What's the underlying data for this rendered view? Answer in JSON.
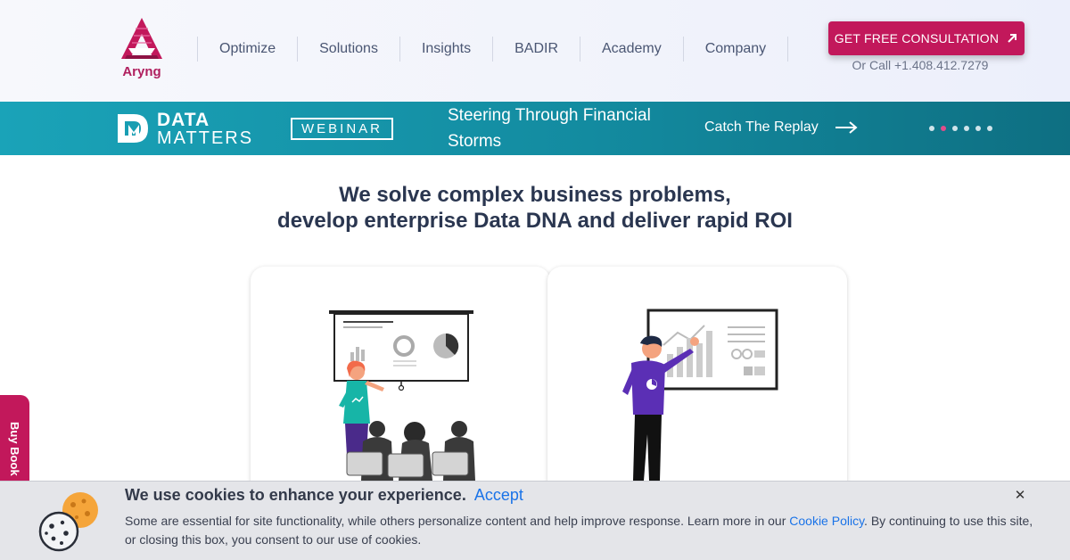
{
  "header": {
    "logo_text": "Aryng",
    "nav": [
      "Optimize",
      "Solutions",
      "Insights",
      "BADIR",
      "Academy",
      "Company"
    ],
    "cta_label": "GET FREE CONSULTATION",
    "call_text": "Or Call +1.408.412.7279"
  },
  "banner": {
    "brand_line1": "DATA",
    "brand_line2": "MATTERS",
    "badge": "WEBINAR",
    "title": "Steering Through Financial Storms",
    "replay_label": "Catch The Replay",
    "slide_count": 6,
    "active_slide": 2
  },
  "main": {
    "headline_line1": "We solve complex business problems,",
    "headline_line2": "develop enterprise Data DNA and deliver rapid ROI"
  },
  "side_tab": {
    "label": "Buy Book"
  },
  "cookie": {
    "title": "We use cookies to enhance your experience.",
    "accept_label": "Accept",
    "text_before": "Some are essential for site functionality, while others personalize content and help improve response. Learn more in our ",
    "policy_link": "Cookie Policy",
    "text_after": ". By continuing to use this site, or closing this box, you consent to our use of cookies.",
    "close_label": "✕"
  },
  "colors": {
    "brand_pink": "#c2185b",
    "banner_teal": "#1aa3b8",
    "banner_teal_dark": "#0e6f82",
    "link_blue": "#1a73e8",
    "cookie_bg": "#e4e5e9"
  }
}
